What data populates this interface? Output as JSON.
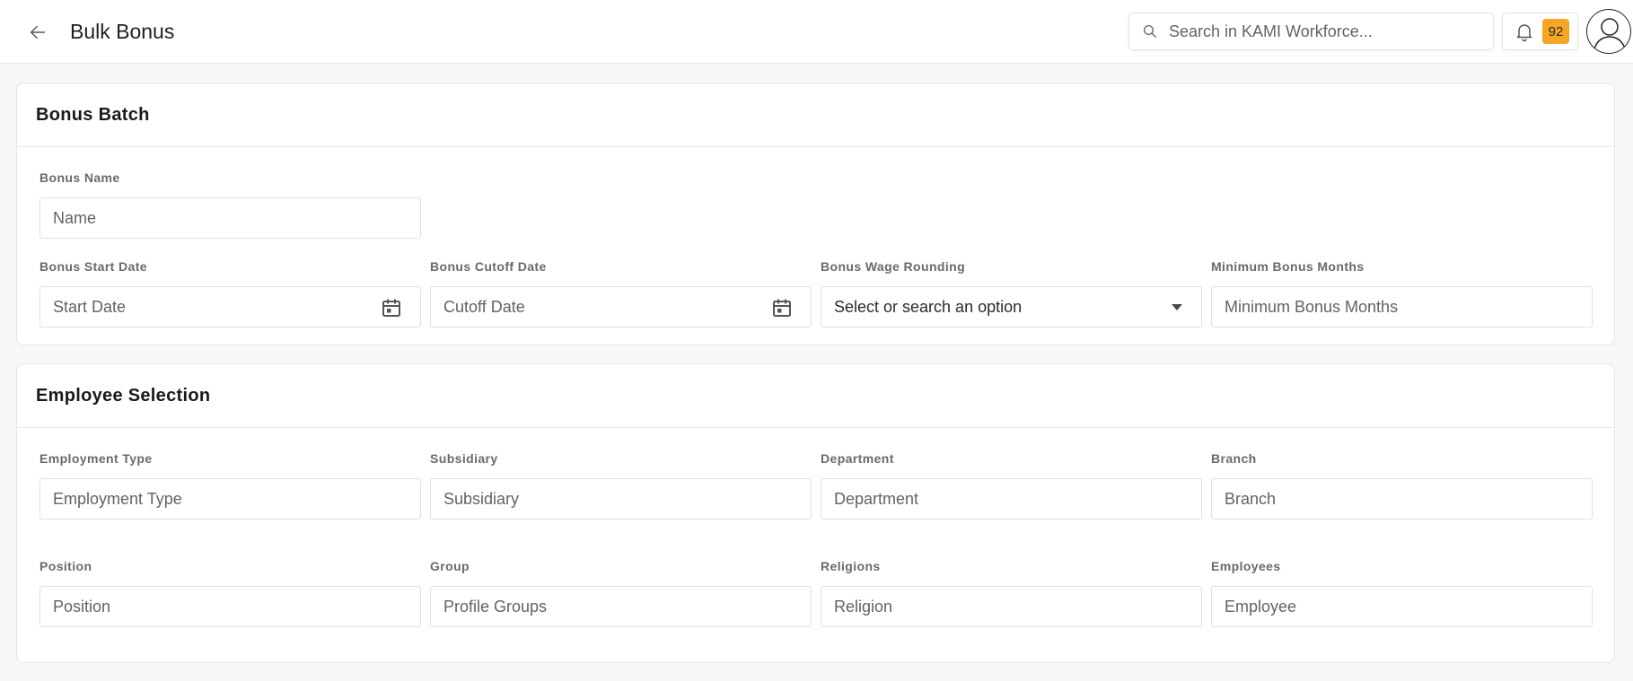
{
  "header": {
    "title": "Bulk Bonus",
    "back_icon": "arrow-left-icon",
    "search_placeholder": "Search in KAMI Workforce...",
    "search_value": "",
    "notification_count": "92",
    "badge_color": "#f5a623"
  },
  "bonus_batch": {
    "title": "Bonus Batch",
    "bonus_name": {
      "label": "Bonus Name",
      "placeholder": "Name"
    },
    "start_date": {
      "label": "Bonus Start Date",
      "placeholder": "Start Date",
      "icon": "calendar-icon"
    },
    "cutoff_date": {
      "label": "Bonus Cutoff Date",
      "placeholder": "Cutoff Date",
      "icon": "calendar-icon"
    },
    "wage_rounding": {
      "label": "Bonus Wage Rounding",
      "placeholder": "Select or search an option"
    },
    "min_months": {
      "label": "Minimum Bonus Months",
      "placeholder": "Minimum Bonus Months"
    }
  },
  "employee_selection": {
    "title": "Employee Selection",
    "employment_type": {
      "label": "Employment Type",
      "placeholder": "Employment Type"
    },
    "subsidiary": {
      "label": "Subsidiary",
      "placeholder": "Subsidiary"
    },
    "department": {
      "label": "Department",
      "placeholder": "Department"
    },
    "branch": {
      "label": "Branch",
      "placeholder": "Branch"
    },
    "position": {
      "label": "Position",
      "placeholder": "Position"
    },
    "group": {
      "label": "Group",
      "placeholder": "Profile Groups"
    },
    "religions": {
      "label": "Religions",
      "placeholder": "Religion"
    },
    "employees": {
      "label": "Employees",
      "placeholder": "Employee"
    }
  }
}
